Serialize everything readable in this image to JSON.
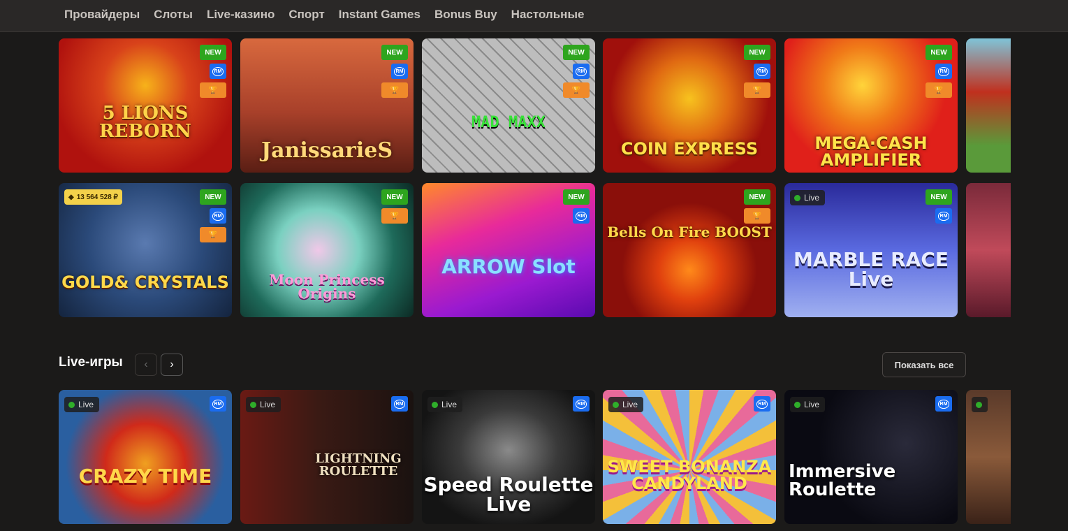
{
  "nav": {
    "items": [
      "Провайдеры",
      "Слоты",
      "Live-казино",
      "Спорт",
      "Instant Games",
      "Bonus Buy",
      "Настольные"
    ]
  },
  "badges": {
    "new": "NEW",
    "rm": "RM",
    "live": "Live"
  },
  "games_row1": [
    {
      "title": "5 LIONS REBORN",
      "badges": [
        "new",
        "rm",
        "trophy"
      ],
      "bg": "#c81a14"
    },
    {
      "title": "JanissarieS",
      "badges": [
        "new",
        "rm",
        "trophy"
      ],
      "bg": "#a5402a"
    },
    {
      "title": "MAD MAXX",
      "badges": [
        "new",
        "rm",
        "trophy"
      ],
      "bg": "#9a9a9a"
    },
    {
      "title": "COIN EXPRESS",
      "badges": [
        "new",
        "rm",
        "trophy"
      ],
      "bg": "#b0140e"
    },
    {
      "title": "MEGA·CASH AMPLIFIER",
      "badges": [
        "new",
        "rm",
        "trophy"
      ],
      "bg": "#e8281a"
    }
  ],
  "games_row2": [
    {
      "title": "GOLD& CRYSTALS",
      "badges": [
        "new",
        "rm",
        "trophy"
      ],
      "jackpot": "13 564 528 ₽",
      "bg": "#2b4a7a"
    },
    {
      "title": "Moon Princess Origins",
      "badges": [
        "new",
        "trophy"
      ],
      "bg": "#1e6a5a"
    },
    {
      "title": "ARROW Slot",
      "badges": [
        "new",
        "rm"
      ],
      "bg": "#c21fb0"
    },
    {
      "title": "Bells On Fire BOOST",
      "badges": [
        "new",
        "trophy"
      ],
      "bg": "#8a0f0a"
    },
    {
      "title": "MARBLE RACE Live",
      "badges": [
        "new",
        "rm"
      ],
      "live": true,
      "bg": "#4a5ad6"
    }
  ],
  "live_section": {
    "title": "Live-игры",
    "show_all": "Показать все",
    "prev_icon": "‹",
    "next_icon": "›"
  },
  "live_games": [
    {
      "title": "CRAZY TIME",
      "bg": "#2a5fa0"
    },
    {
      "title": "LIGHTNING ROULETTE",
      "bg": "#3a1a14"
    },
    {
      "title": "Speed Roulette Live",
      "bg": "#222"
    },
    {
      "title": "SWEET BONANZA CANDYLAND",
      "bg": "#e4a02a"
    },
    {
      "title": "Immersive Roulette",
      "bg": "#0a0a12"
    }
  ]
}
